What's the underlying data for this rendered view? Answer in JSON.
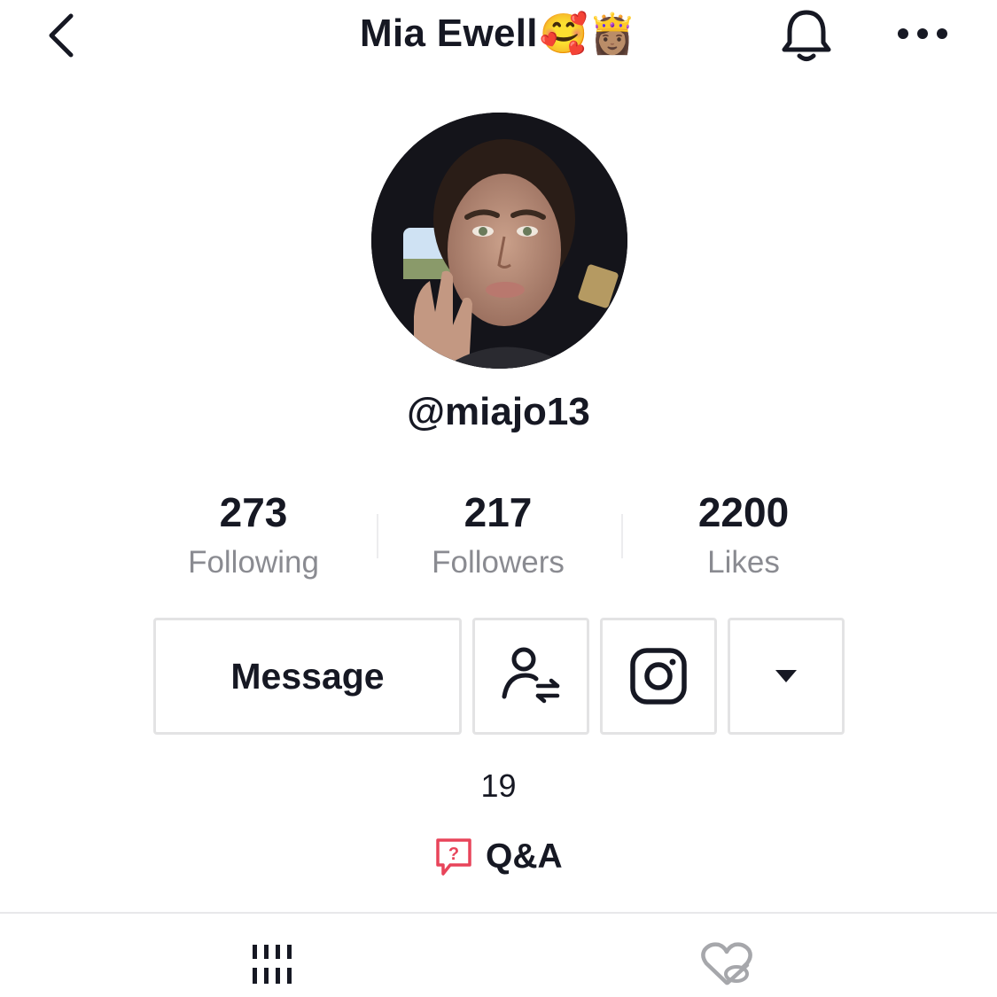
{
  "header": {
    "title": "Mia Ewell",
    "title_emojis": "🥰👸🏽",
    "back_icon": "chevron-left-icon",
    "bell_icon": "bell-icon",
    "more_icon": "more-horizontal-icon"
  },
  "profile": {
    "username": "@miajo13",
    "avatar_alt": "profile photo"
  },
  "stats": [
    {
      "value": "273",
      "label": "Following"
    },
    {
      "value": "217",
      "label": "Followers"
    },
    {
      "value": "2200",
      "label": "Likes"
    }
  ],
  "actions": {
    "message_label": "Message",
    "friend_icon": "user-swap-icon",
    "instagram_icon": "instagram-icon",
    "dropdown_icon": "caret-down-icon"
  },
  "bio": "19",
  "qa": {
    "label": "Q&A",
    "icon": "question-bubble-icon",
    "accent": "#e8445a"
  },
  "tabs": {
    "videos_icon": "grid-icon",
    "liked_icon": "heart-hidden-icon"
  },
  "colors": {
    "text": "#161823",
    "muted": "#8a8b91",
    "border": "#e3e3e4"
  }
}
